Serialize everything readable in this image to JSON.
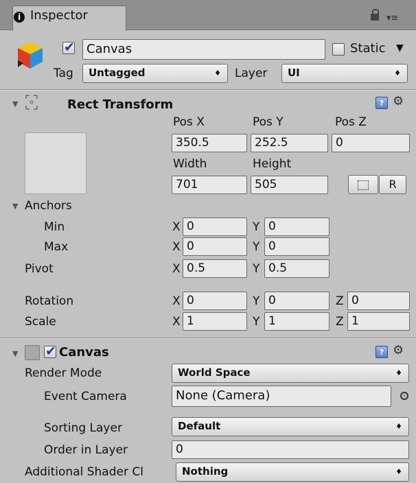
{
  "window": {
    "tab_title": "Inspector",
    "tab_icon": "info-icon",
    "header_icons": [
      "lock-icon",
      "menu-icon"
    ]
  },
  "gameobject": {
    "active": true,
    "name": "Canvas",
    "static_label": "Static",
    "static_checked": false,
    "tag_label": "Tag",
    "tag_value": "Untagged",
    "layer_label": "Layer",
    "layer_value": "UI"
  },
  "rect_transform": {
    "title": "Rect Transform",
    "pos_x_label": "Pos X",
    "pos_y_label": "Pos Y",
    "pos_z_label": "Pos Z",
    "pos_x": "350.5",
    "pos_y": "252.5",
    "pos_z": "0",
    "width_label": "Width",
    "height_label": "Height",
    "width": "701",
    "height": "505",
    "r_button_label": "R",
    "anchors_label": "Anchors",
    "min_label": "Min",
    "max_label": "Max",
    "anchors_min_x": "0",
    "anchors_min_y": "0",
    "anchors_max_x": "0",
    "anchors_max_y": "0",
    "pivot_label": "Pivot",
    "pivot_x": "0.5",
    "pivot_y": "0.5",
    "rotation_label": "Rotation",
    "rotation_x": "0",
    "rotation_y": "0",
    "rotation_z": "0",
    "scale_label": "Scale",
    "scale_x": "1",
    "scale_y": "1",
    "scale_z": "1",
    "axis_x": "X",
    "axis_y": "Y",
    "axis_z": "Z"
  },
  "canvas": {
    "title": "Canvas",
    "enabled": true,
    "render_mode_label": "Render Mode",
    "render_mode": "World Space",
    "event_camera_label": "Event Camera",
    "event_camera": "None (Camera)",
    "sorting_layer_label": "Sorting Layer",
    "sorting_layer": "Default",
    "order_in_layer_label": "Order in Layer",
    "order_in_layer": "0",
    "shader_channels_label": "Additional Shader Cl",
    "shader_channels": "Nothing"
  },
  "colors": {
    "panel": "#c2c2c2",
    "field": "#e9e9e9",
    "check": "#1b3f86"
  }
}
